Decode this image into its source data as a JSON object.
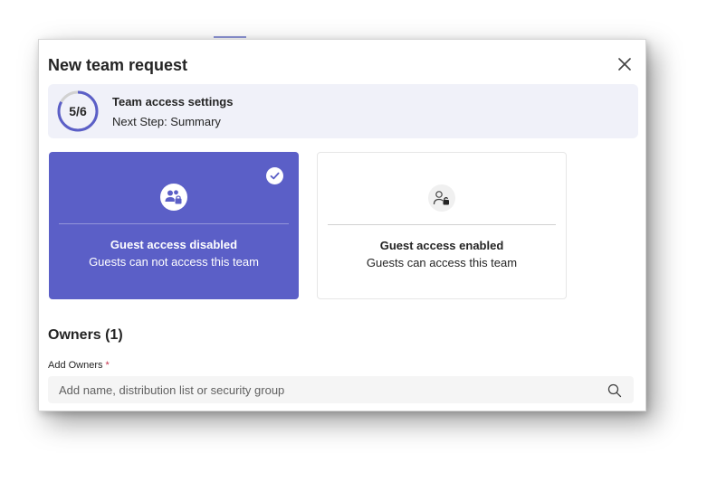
{
  "dialog": {
    "title": "New team request"
  },
  "step": {
    "progress_label": "5/6",
    "progress_fraction": 0.83,
    "title": "Team access settings",
    "next_step": "Next Step: Summary"
  },
  "cards": [
    {
      "title": "Guest access disabled",
      "description": "Guests can not access this team",
      "selected": true,
      "icon": "guest-lock-icon"
    },
    {
      "title": "Guest access enabled",
      "description": "Guests can access this team",
      "selected": false,
      "icon": "guest-unlock-icon"
    }
  ],
  "owners": {
    "heading": "Owners (1)",
    "add_label": "Add Owners",
    "required_mark": "*",
    "search_placeholder": "Add name, distribution list or security group",
    "search_value": ""
  },
  "colors": {
    "accent": "#5b5fc7",
    "required": "#c4314b"
  }
}
